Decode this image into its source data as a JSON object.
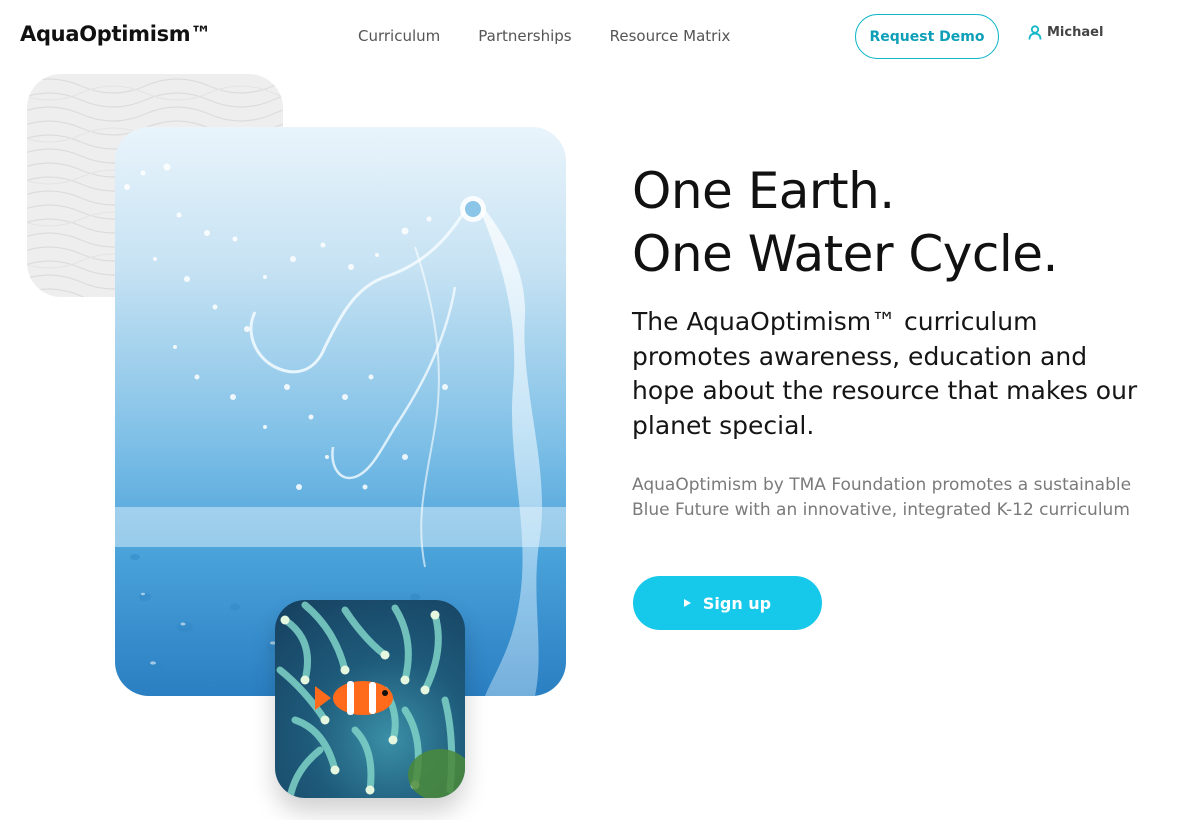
{
  "header": {
    "logo": "AquaOptimism™",
    "nav": [
      {
        "label": "Curriculum"
      },
      {
        "label": "Partnerships"
      },
      {
        "label": "Resource Matrix"
      }
    ],
    "request_demo_label": "Request Demo",
    "user_name": "Michael"
  },
  "hero": {
    "headline_line1": "One Earth.",
    "headline_line2": "One Water Cycle.",
    "subhead": "The AquaOptimism™ curriculum promotes awareness, education and hope about the resource that makes our planet special.",
    "body": "AquaOptimism by TMA Foundation promotes a sustainable Blue Future with an innovative, integrated K-12 curriculum",
    "signup_label": "Sign up"
  },
  "colors": {
    "accent": "#16c8e9",
    "accent_dark": "#0e9fb8",
    "text": "#111111",
    "muted_text": "#7a7a7a"
  },
  "icons": {
    "user": "user-icon",
    "play": "play-icon"
  }
}
